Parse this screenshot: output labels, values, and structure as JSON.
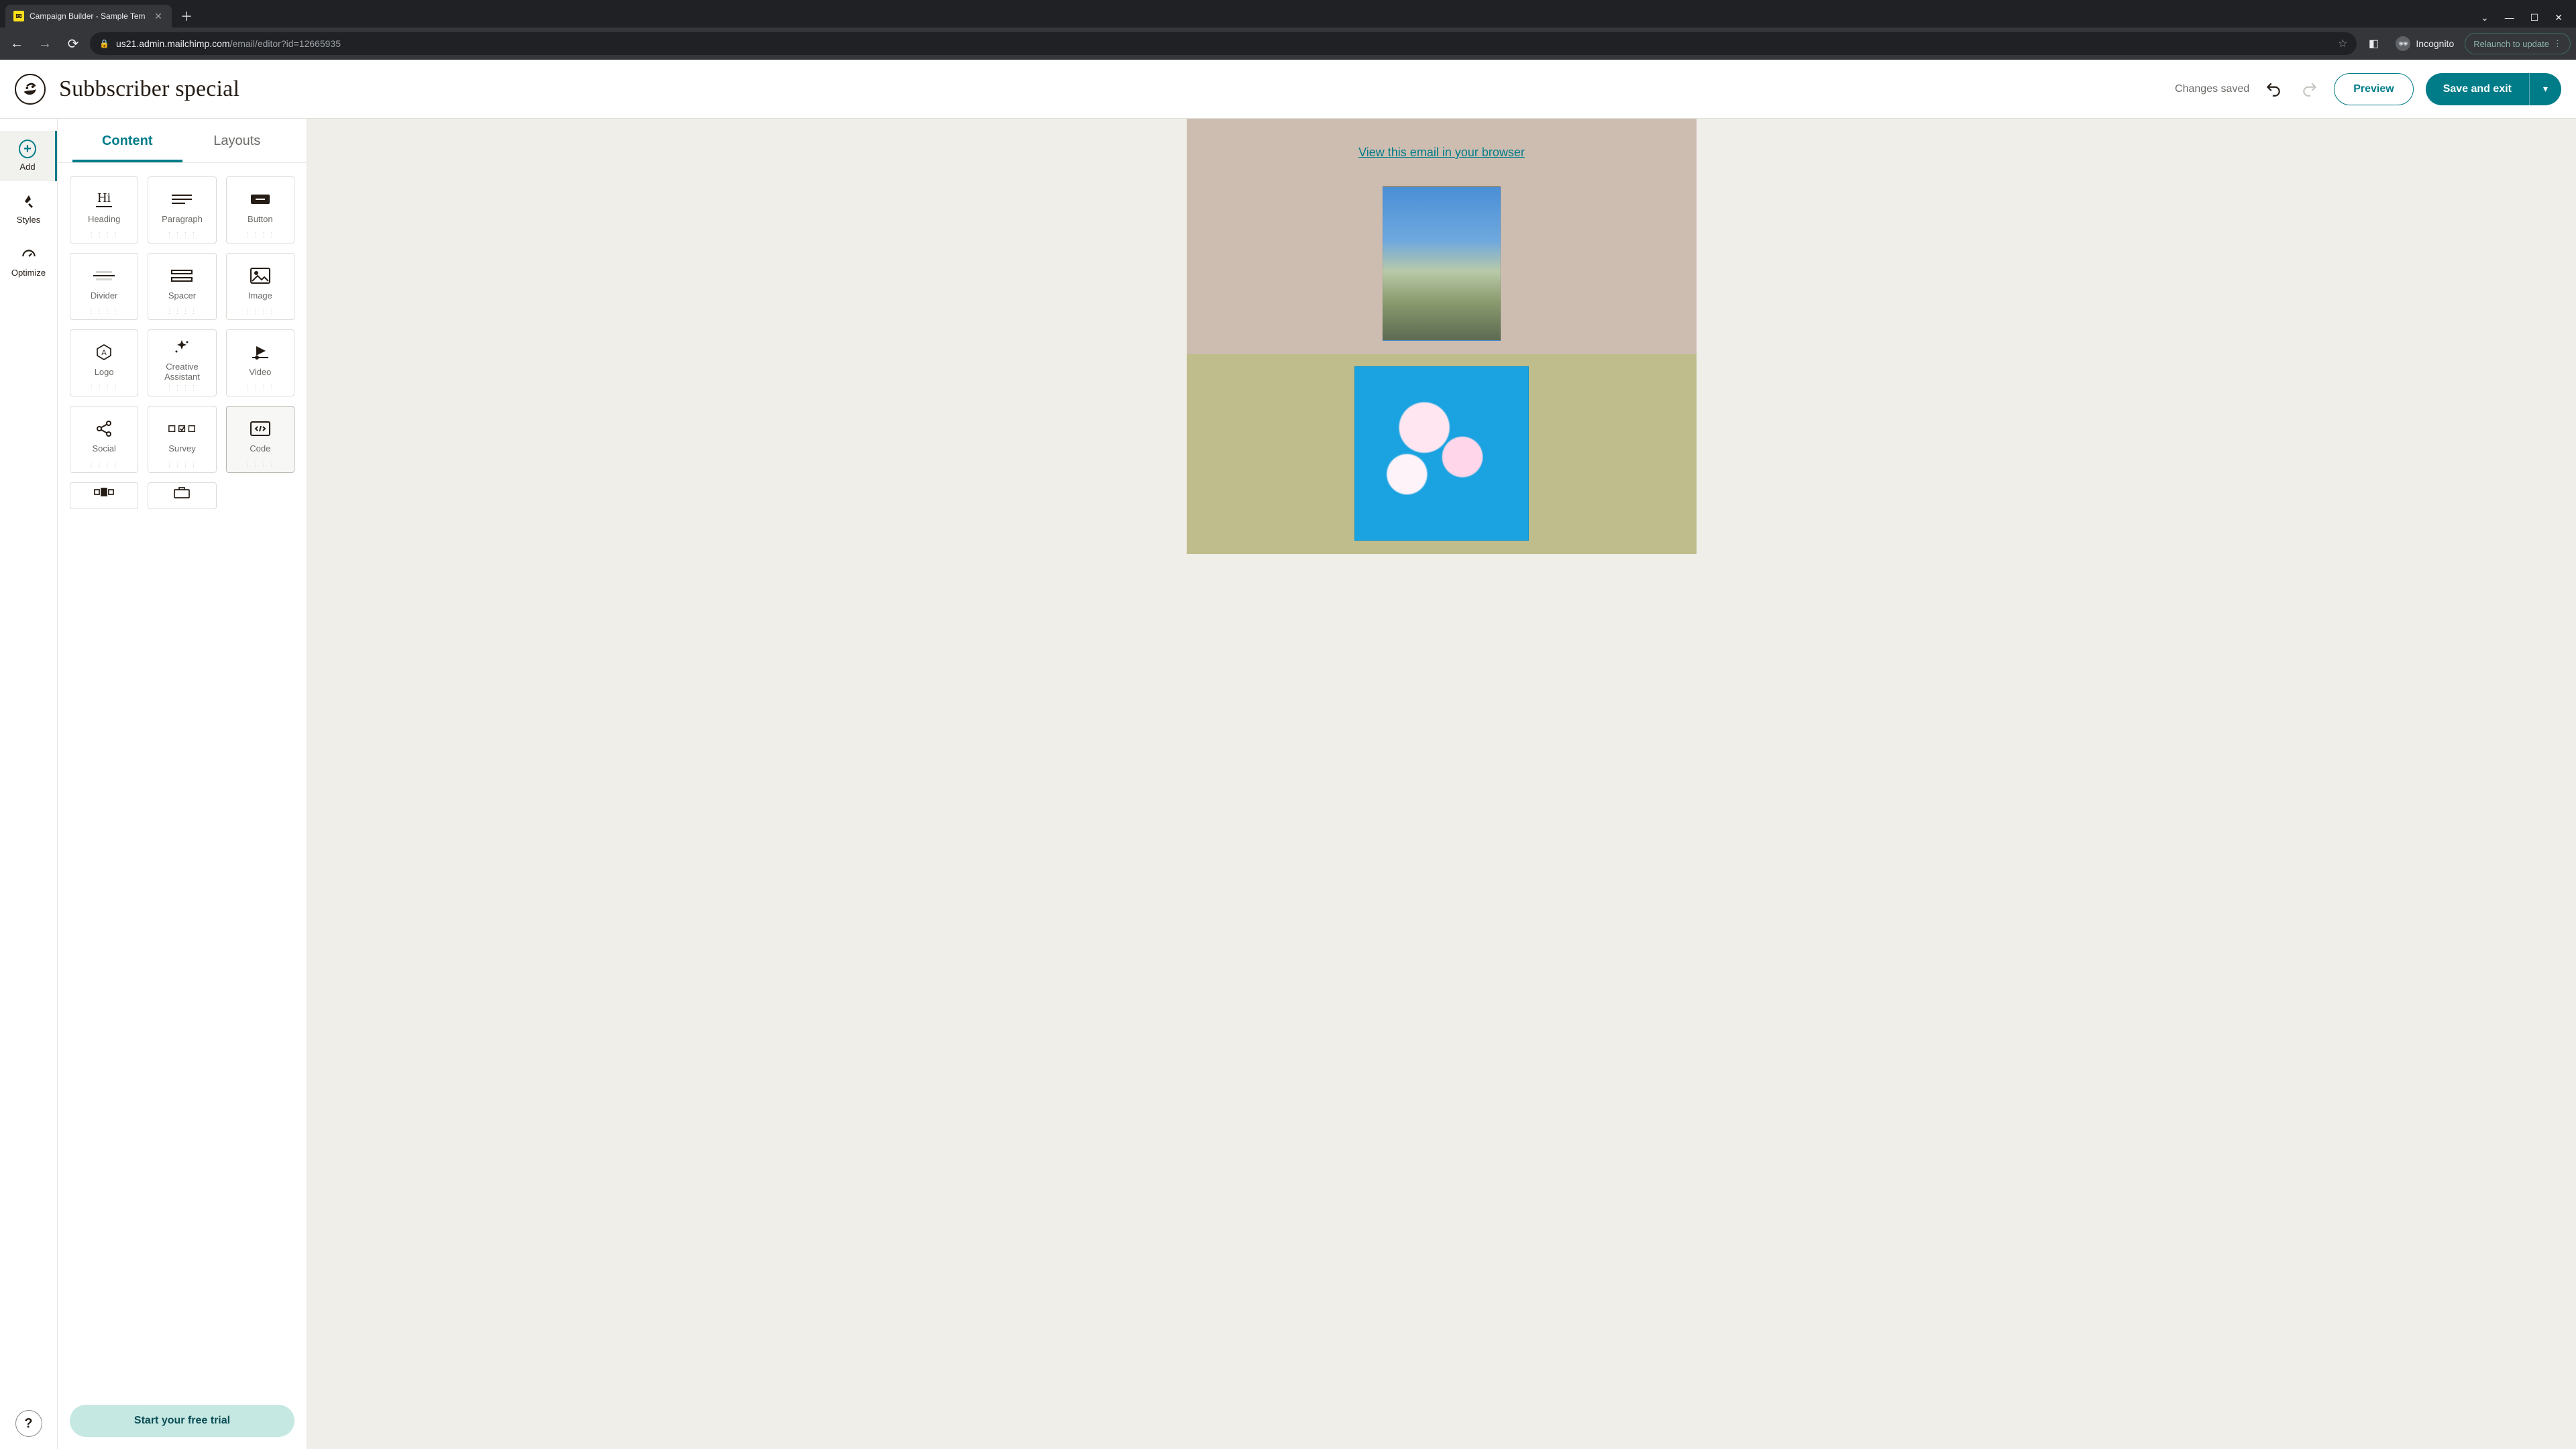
{
  "browser": {
    "tab_title": "Campaign Builder - Sample Tem",
    "url_host": "us21.admin.mailchimp.com",
    "url_path": "/email/editor?id=12665935",
    "incognito_label": "Incognito",
    "relaunch_label": "Relaunch to update"
  },
  "header": {
    "campaign_title": "Subbscriber special",
    "saved_status": "Changes saved",
    "preview_label": "Preview",
    "save_label": "Save and exit"
  },
  "rail": {
    "add": "Add",
    "styles": "Styles",
    "optimize": "Optimize",
    "help": "?"
  },
  "panel": {
    "tabs": {
      "content": "Content",
      "layouts": "Layouts"
    },
    "active_tab": "content",
    "trial_cta": "Start your free trial"
  },
  "blocks": [
    {
      "key": "heading",
      "label": "Heading"
    },
    {
      "key": "paragraph",
      "label": "Paragraph"
    },
    {
      "key": "button",
      "label": "Button"
    },
    {
      "key": "divider",
      "label": "Divider"
    },
    {
      "key": "spacer",
      "label": "Spacer"
    },
    {
      "key": "image",
      "label": "Image"
    },
    {
      "key": "logo",
      "label": "Logo"
    },
    {
      "key": "creative",
      "label": "Creative Assistant"
    },
    {
      "key": "video",
      "label": "Video"
    },
    {
      "key": "social",
      "label": "Social"
    },
    {
      "key": "survey",
      "label": "Survey"
    },
    {
      "key": "code",
      "label": "Code"
    }
  ],
  "canvas": {
    "view_in_browser": "View this email in your browser"
  },
  "colors": {
    "brand_teal": "#007c89",
    "brand_yellow": "#ffe01b",
    "canvas_top": "#cdbdb0",
    "canvas_bottom": "#c0bd8c"
  }
}
